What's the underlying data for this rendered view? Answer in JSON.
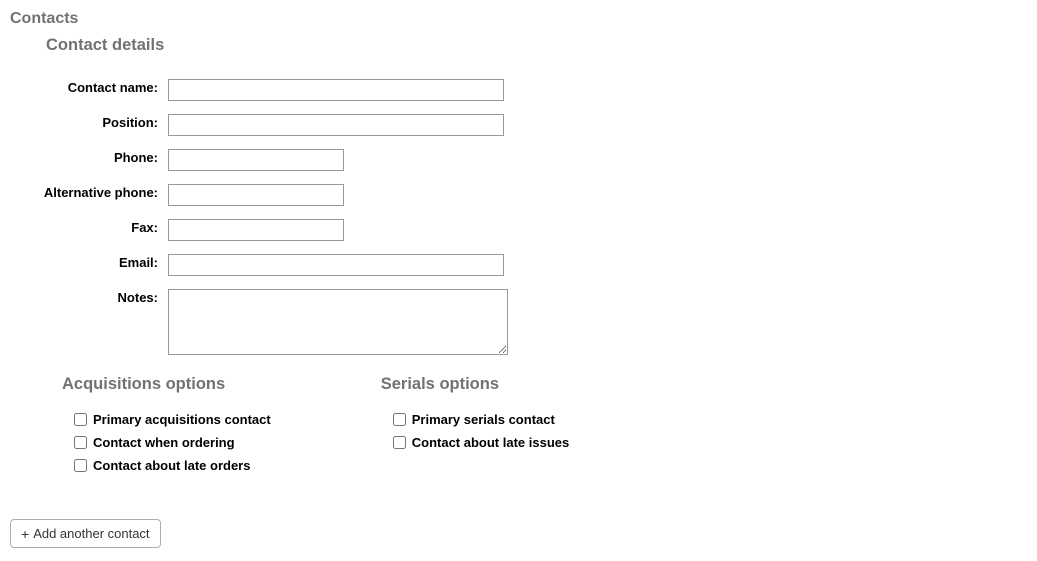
{
  "headings": {
    "contacts": "Contacts",
    "contact_details": "Contact details",
    "acquisitions_options": "Acquisitions options",
    "serials_options": "Serials options"
  },
  "fields": {
    "contact_name": {
      "label": "Contact name:",
      "value": ""
    },
    "position": {
      "label": "Position:",
      "value": ""
    },
    "phone": {
      "label": "Phone:",
      "value": ""
    },
    "alt_phone": {
      "label": "Alternative phone:",
      "value": ""
    },
    "fax": {
      "label": "Fax:",
      "value": ""
    },
    "email": {
      "label": "Email:",
      "value": ""
    },
    "notes": {
      "label": "Notes:",
      "value": ""
    }
  },
  "acquisitions": {
    "primary": {
      "label": "Primary acquisitions contact",
      "checked": false
    },
    "ordering": {
      "label": "Contact when ordering",
      "checked": false
    },
    "late_orders": {
      "label": "Contact about late orders",
      "checked": false
    }
  },
  "serials": {
    "primary": {
      "label": "Primary serials contact",
      "checked": false
    },
    "late_issues": {
      "label": "Contact about late issues",
      "checked": false
    }
  },
  "buttons": {
    "add_another": "Add another contact"
  }
}
